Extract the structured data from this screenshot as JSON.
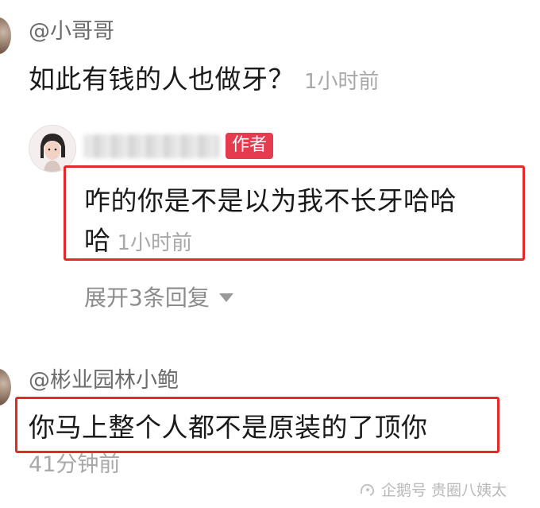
{
  "comment1": {
    "username": "@小哥哥",
    "text": "如此有钱的人也做牙？",
    "time": "1小时前"
  },
  "reply": {
    "badge": "作者",
    "text_line1": "咋的你是不是以为我不长牙哈哈",
    "text_line2": "哈",
    "time": "1小时前",
    "expand_label": "展开3条回复"
  },
  "comment2": {
    "username": "@彬业园林小鲍",
    "text": "你马上整个人都不是原装的了顶你",
    "time": "41分钟前"
  },
  "watermark": {
    "text": "企鹅号 贵圈八姨太"
  },
  "colors": {
    "highlight_border": "#e12b2b",
    "author_badge": "#e63a4f",
    "username": "#6b6b6b",
    "timestamp": "#a8a8a8"
  }
}
